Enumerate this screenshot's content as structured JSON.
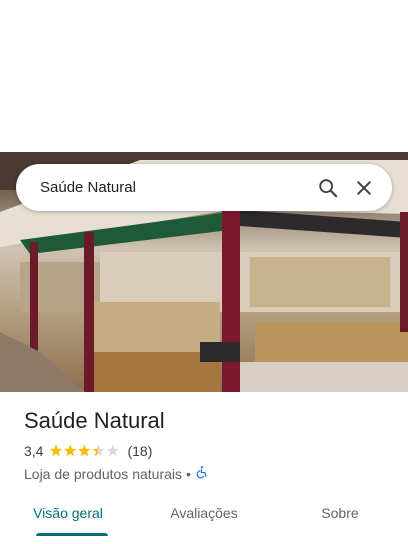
{
  "search": {
    "query": "Saúde Natural"
  },
  "place": {
    "name": "Saúde Natural",
    "rating": "3,4",
    "stars_value": 3.4,
    "reviews_count": "(18)",
    "category": "Loja de produtos naturais",
    "separator": "•"
  },
  "tabs": [
    {
      "label": "Visão geral",
      "active": true
    },
    {
      "label": "Avaliações",
      "active": false
    },
    {
      "label": "Sobre",
      "active": false
    }
  ],
  "colors": {
    "accent": "#00707a",
    "star": "#fbbc04",
    "star_empty": "#dadce0",
    "accessibility": "#1a73e8"
  },
  "icons": [
    "search-icon",
    "close-icon",
    "star-icon",
    "accessibility-icon"
  ]
}
